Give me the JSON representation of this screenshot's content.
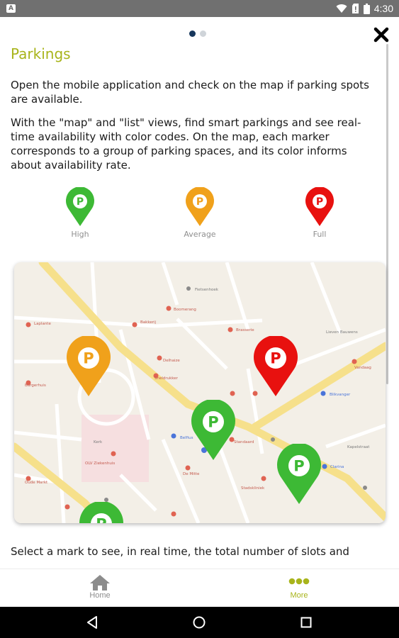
{
  "status_bar": {
    "time": "4:30",
    "app_badge": "A"
  },
  "pager": {
    "total": 2,
    "active": 1
  },
  "page": {
    "title": "Parkings",
    "paragraph1": "Open the mobile application and check on the map if parking spots are available.",
    "paragraph2": "With the \"map\" and \"list\" views, find smart parkings and see real-time availability with color codes. On the map, each marker corresponds to a group of parking spaces, and its color informs about availability rate.",
    "paragraph3": "Select a mark to see, in real time, the total number of slots and"
  },
  "legend": [
    {
      "label": "High",
      "color": "#3db935"
    },
    {
      "label": "Average",
      "color": "#f0a11b"
    },
    {
      "label": "Full",
      "color": "#e8110f"
    }
  ],
  "marker_letter": "P",
  "map": {
    "colors": {
      "green": "#3db935",
      "orange": "#f0a11b",
      "red": "#e8110f",
      "road": "#f6e08b",
      "poi": "#e06352"
    },
    "labels": {
      "l1": "Laplante",
      "l2": "Fietsenhoek",
      "l3": "Bakkerij",
      "l4": "Boomerang",
      "l5": "Belfius",
      "l6": "Blikvanger",
      "l7": "Burgerhuis",
      "l8": "Delhaize",
      "l9": "Clarina",
      "l10": "Brasserie",
      "l11": "De Mitte",
      "l12": "Lieven Bauwens",
      "l13": "Kerk",
      "l14": "Sneldrukker",
      "l15": "Standaard",
      "l16": "Vandaag",
      "l17": "OLV Ziekenhuis",
      "l18": "Stadskliniek",
      "l19": "Oude Markt",
      "l20": "Kapelstraat"
    }
  },
  "bottom_nav": {
    "home": {
      "label": "Home",
      "color": "#8c8c8c"
    },
    "more": {
      "label": "More",
      "color": "#a8b41b"
    }
  }
}
